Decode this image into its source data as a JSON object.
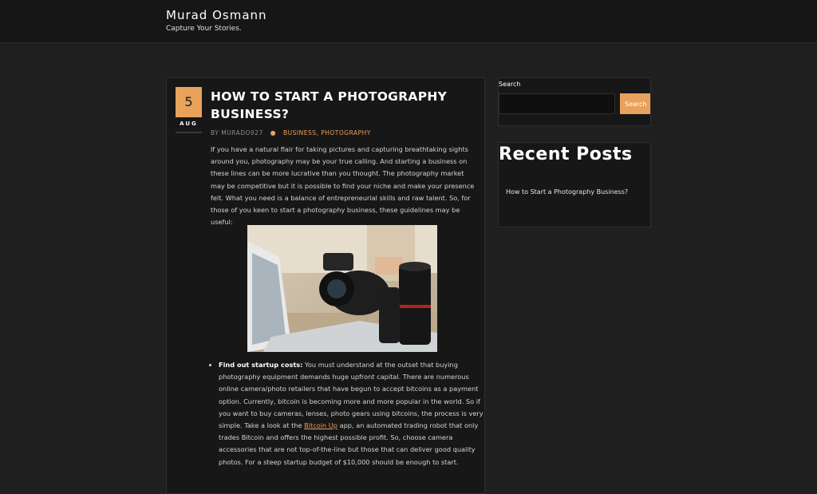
{
  "site": {
    "title": "Murad Osmann",
    "tagline": "Capture Your Stories."
  },
  "post": {
    "date_day": "5",
    "date_month": "AUG",
    "title": "HOW TO START A PHOTOGRAPHY BUSINESS?",
    "by_label": "BY",
    "author": "MURADO927",
    "categories": "BUSINESS, PHOTOGRAPHY",
    "intro": "If you have a natural flair for taking pictures and capturing breathtaking sights around you, photography may be your true calling. And starting a business on these lines can be more lucrative than you thought. The photography market may be competitive but it is possible to find your niche and make your presence felt. What you need is a balance of entrepreneurial skills and raw talent. So, for those of you keen to start a photography business, these guidelines may be useful:",
    "bullet_heading": "Find out startup costs:",
    "bullet_text_1": " You must understand at the outset that buying photography equipment demands huge upfront capital. There are numerous online camera/photo retailers that have begun to accept bitcoins as a payment option. Currently, bitcoin is becoming more and more popular in the world. So if you want to buy cameras, lenses, photo gears using bitcoins, the process is very simple. Take a look at the ",
    "bullet_link": "Bitcoin Up",
    "bullet_text_2": " app, an automated trading robot that only trades Bitcoin and offers the highest possible profit. So, choose camera accessories that are not top-of-the-line but those that can deliver good quality photos. For a steep startup budget of $10,000 should be enough to start."
  },
  "sidebar": {
    "search_label": "Search",
    "search_value": "",
    "search_button": "Search",
    "recent_title": "Recent Posts",
    "recent_items": [
      "How to Start a Photography Business?"
    ]
  },
  "colors": {
    "accent": "#e8a25b",
    "background": "#1f1f1f",
    "panel": "#171717",
    "header": "#161616"
  }
}
